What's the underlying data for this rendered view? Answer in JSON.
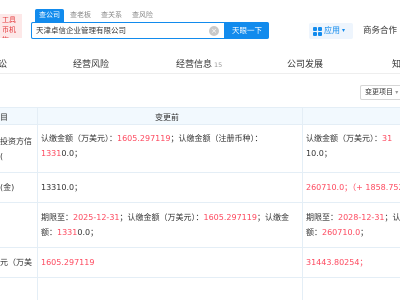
{
  "header": {
    "logo_text": "工具\n币机构",
    "tabs": [
      "查公司",
      "查老板",
      "查关系",
      "查风险"
    ],
    "search_value": "天津卓信企业管理有限公司",
    "search_button": "天眼一下",
    "apps_label": "应用",
    "biz_label": "商务合作"
  },
  "nav": {
    "items": [
      "讼",
      "经营风险",
      "经营信息",
      "公司发展",
      "知"
    ],
    "info_count": "15"
  },
  "filter": {
    "label": "变更项目"
  },
  "table": {
    "headers": [
      "目",
      "变更前"
    ],
    "rows": [
      {
        "item": "投资方信\n(",
        "before": {
          "a": "认缴金额（万美元）：",
          "b": "1605.297119",
          "c": "；认缴金额（注册币种）：",
          "d": "1331",
          "e": "0.0；"
        },
        "after": {
          "a": "认缴金额（万美元）：",
          "b": "31",
          "c": "10.0；"
        }
      },
      {
        "item": "(金)",
        "before": "13310.0；",
        "after": "260710.0；（+ 1858.752"
      },
      {
        "item": "",
        "before": {
          "a": "期限至：",
          "b": "2025-12-31",
          "c": "；认缴金额（万美元）：",
          "d": "1605.297119",
          "e": "；认缴金额：",
          "f": "1331",
          "g": "0.0",
          "h": "；"
        },
        "after": {
          "a": "期限至：",
          "b": "2028-12-31",
          "c": "；认",
          "d": "额：",
          "e": "260710.0",
          "f": "；"
        }
      },
      {
        "item": "元（万美",
        "before": "1605.297119",
        "after": "31443.80254；"
      }
    ]
  },
  "colors": {
    "accent": "#128bed",
    "red": "#fd485e",
    "header_bg": "#f2f9fe"
  },
  "icons": [
    "grid-icon",
    "caret-down-icon",
    "clear-icon"
  ]
}
